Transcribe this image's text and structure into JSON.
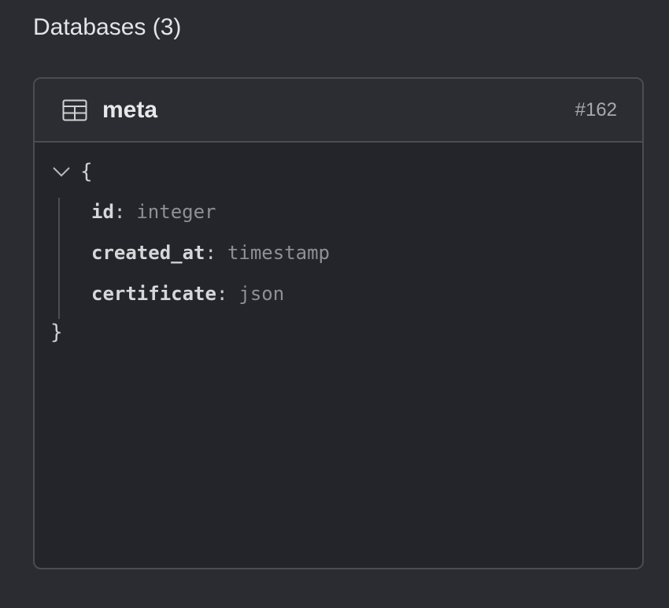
{
  "section": {
    "title": "Databases (3)"
  },
  "card": {
    "icon": "table-icon",
    "title": "meta",
    "id": "#162",
    "schema": {
      "open_brace": "{",
      "close_brace": "}",
      "toggle_icon": "chevron-down-icon",
      "fields": [
        {
          "name": "id",
          "colon": ":",
          "type": "integer"
        },
        {
          "name": "created_at",
          "colon": ":",
          "type": "timestamp"
        },
        {
          "name": "certificate",
          "colon": ":",
          "type": "json"
        }
      ]
    }
  },
  "colors": {
    "background": "#2a2c31",
    "card_background": "#23252a",
    "border": "#4a4d53",
    "type_text": "#8d9095"
  }
}
